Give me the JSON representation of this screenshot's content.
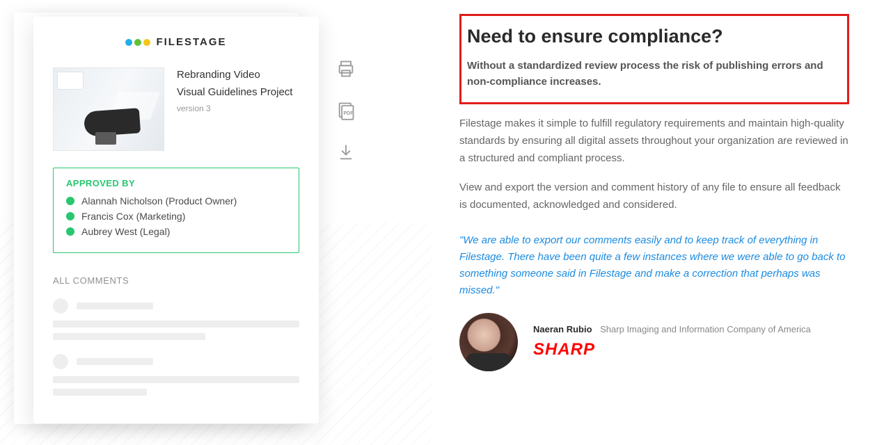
{
  "card": {
    "brand": "FILESTAGE",
    "project_line1": "Rebranding Video",
    "project_line2": "Visual Guidelines Project",
    "version": "version 3",
    "approved_title": "APPROVED BY",
    "approvers": [
      "Alannah Nicholson (Product Owner)",
      "Francis Cox (Marketing)",
      "Aubrey West (Legal)"
    ],
    "comments_title": "ALL COMMENTS"
  },
  "actions": {
    "print": "print-icon",
    "pdf": "pdf-icon",
    "download": "download-icon"
  },
  "content": {
    "heading": "Need to ensure compliance?",
    "lead": "Without a standardized review process the risk of publishing errors and non-compliance increases.",
    "para1": "Filestage makes it simple to fulfill regulatory requirements and maintain high-quality standards by ensuring all digital assets throughout your organization are reviewed in a structured and compliant process.",
    "para2": "View and export the version and comment history of any file to ensure all feedback is documented, acknowledged and considered.",
    "quote": "\"We are able to export our comments easily and to keep track of everything in Filestage. There have been quite a few instances where we were able to go back to something someone said in Filestage and make a correction that perhaps was missed.\""
  },
  "testimonial": {
    "name": "Naeran Rubio",
    "company": "Sharp Imaging and Information Company of America",
    "brand": "SHARP"
  }
}
